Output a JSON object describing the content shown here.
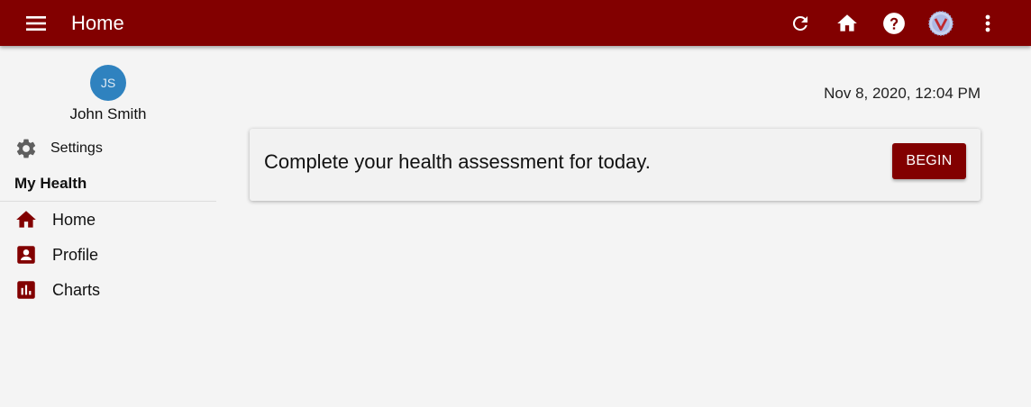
{
  "appbar": {
    "title": "Home",
    "background": "#820000",
    "icons": [
      "menu-icon",
      "refresh-icon",
      "home-icon",
      "help-icon",
      "app-logo-icon",
      "more-vert-icon"
    ]
  },
  "sidebar": {
    "avatar_initials": "JS",
    "avatar_color": "#2f82bf",
    "user_name": "John Smith",
    "settings_label": "Settings",
    "section_title": "My Health",
    "items": [
      {
        "label": "Home",
        "icon": "home-icon"
      },
      {
        "label": "Profile",
        "icon": "profile-icon"
      },
      {
        "label": "Charts",
        "icon": "chart-icon"
      }
    ]
  },
  "main": {
    "timestamp": "Nov 8, 2020, 12:04 PM",
    "card": {
      "message": "Complete your health assessment for today.",
      "button_label": "BEGIN"
    }
  }
}
